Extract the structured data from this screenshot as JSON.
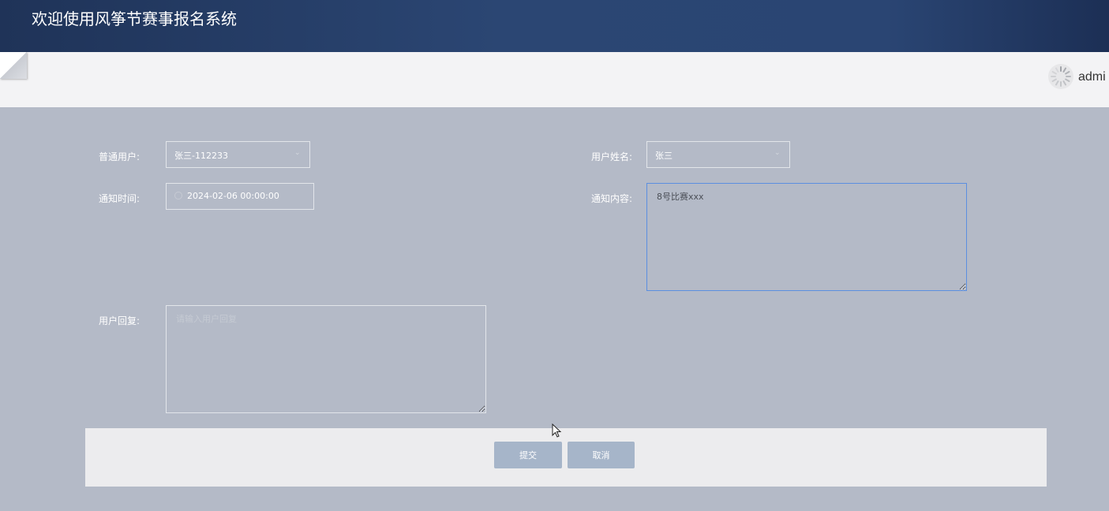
{
  "header": {
    "app_title": "欢迎使用风筝节赛事报名系统"
  },
  "user_menu": {
    "username": "admi"
  },
  "form": {
    "normal_user": {
      "label": "普通用户:",
      "value": "张三-112233"
    },
    "user_name": {
      "label": "用户姓名:",
      "value": "张三"
    },
    "notify_time": {
      "label": "通知时间:",
      "value": "2024-02-06 00:00:00"
    },
    "notify_content": {
      "label": "通知内容:",
      "value": "8号比赛xxx"
    },
    "user_reply": {
      "label": "用户回复:",
      "placeholder": "请输入用户回复",
      "value": ""
    }
  },
  "actions": {
    "submit_label": "提交",
    "cancel_label": "取消"
  },
  "colors": {
    "header_bg": "#2b4673",
    "content_bg": "#b4bac7",
    "button_bg": "#a6b5c9",
    "focus_border": "#5b8fe0"
  }
}
